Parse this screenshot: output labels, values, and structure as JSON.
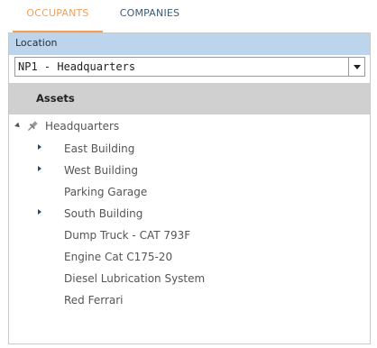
{
  "tabs": [
    {
      "label": "OCCUPANTS",
      "active": true
    },
    {
      "label": "COMPANIES",
      "active": false
    }
  ],
  "location": {
    "header": "Location",
    "selected": "NP1 - Headquarters"
  },
  "assets": {
    "header": "Assets",
    "tree": [
      {
        "label": "Headquarters",
        "level": 0,
        "state": "expanded",
        "icon": "pin-icon"
      },
      {
        "label": "East Building",
        "level": 1,
        "state": "collapsed"
      },
      {
        "label": "West Building",
        "level": 1,
        "state": "collapsed"
      },
      {
        "label": "Parking Garage",
        "level": 1,
        "state": "leaf"
      },
      {
        "label": "South Building",
        "level": 1,
        "state": "collapsed"
      },
      {
        "label": "Dump Truck - CAT 793F",
        "level": 1,
        "state": "leaf"
      },
      {
        "label": "Engine Cat C175-20",
        "level": 1,
        "state": "leaf"
      },
      {
        "label": "Diesel Lubrication System",
        "level": 1,
        "state": "leaf"
      },
      {
        "label": "Red Ferrari",
        "level": 1,
        "state": "leaf"
      }
    ]
  },
  "colors": {
    "active_tab": "#f0a05a",
    "inactive_tab": "#3b5a7a",
    "location_header_bg": "#bcd5ec",
    "assets_header_bg": "#d0d0d0"
  }
}
